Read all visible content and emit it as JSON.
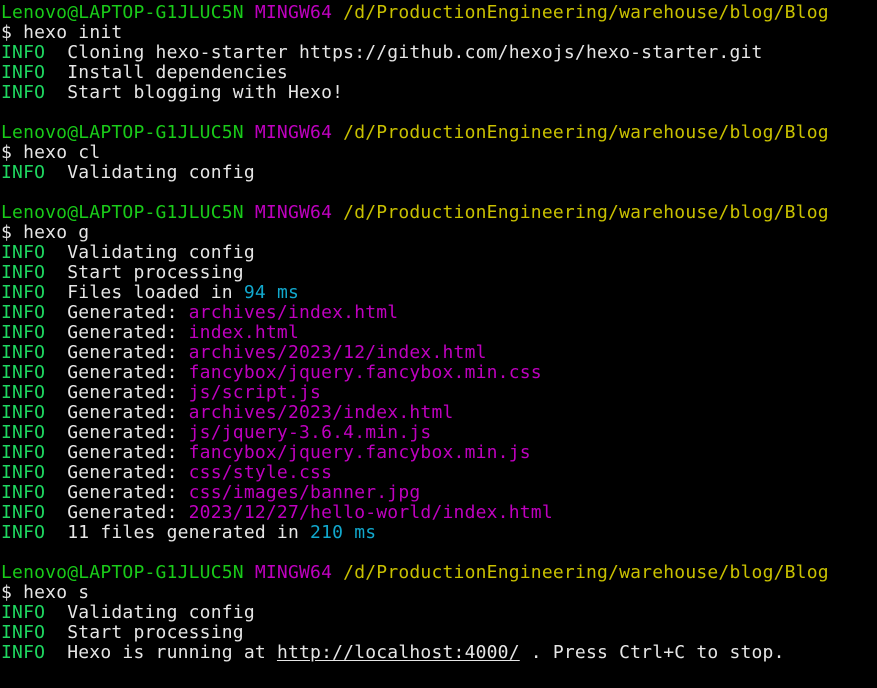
{
  "colors": {
    "background": "#000000",
    "info": "#19cb19",
    "host": "#19cb19",
    "mingw": "#bf00bf",
    "path": "#c9c100",
    "text": "#e6e6e6",
    "number": "#11a8cd",
    "file": "#bf00bf"
  },
  "prompt": {
    "user_host": "Lenovo@LAPTOP-G1JLUC5N",
    "env": "MINGW64",
    "path": "/d/ProductionEngineering/warehouse/blog/Blog",
    "symbol": "$"
  },
  "info_tag": "INFO",
  "blocks": [
    {
      "command": "hexo init",
      "lines": [
        "Cloning hexo-starter https://github.com/hexojs/hexo-starter.git",
        "Install dependencies",
        "Start blogging with Hexo!"
      ]
    },
    {
      "command": "hexo cl",
      "lines": [
        "Validating config"
      ]
    },
    {
      "command": "hexo g",
      "lines": [
        "Validating config",
        "Start processing"
      ],
      "files_loaded": {
        "prefix": "Files loaded in ",
        "value": "94 ms"
      },
      "generated_label": "Generated: ",
      "generated_files": [
        "archives/index.html",
        "index.html",
        "archives/2023/12/index.html",
        "fancybox/jquery.fancybox.min.css",
        "js/script.js",
        "archives/2023/index.html",
        "js/jquery-3.6.4.min.js",
        "fancybox/jquery.fancybox.min.js",
        "css/style.css",
        "css/images/banner.jpg",
        "2023/12/27/hello-world/index.html"
      ],
      "files_generated": {
        "prefix": "11 files generated in ",
        "value": "210 ms"
      }
    },
    {
      "command": "hexo s",
      "lines": [
        "Validating config",
        "Start processing"
      ],
      "running": {
        "prefix": "Hexo is running at ",
        "url": "http://localhost:4000/",
        "suffix": " . Press Ctrl+C to stop."
      }
    }
  ]
}
